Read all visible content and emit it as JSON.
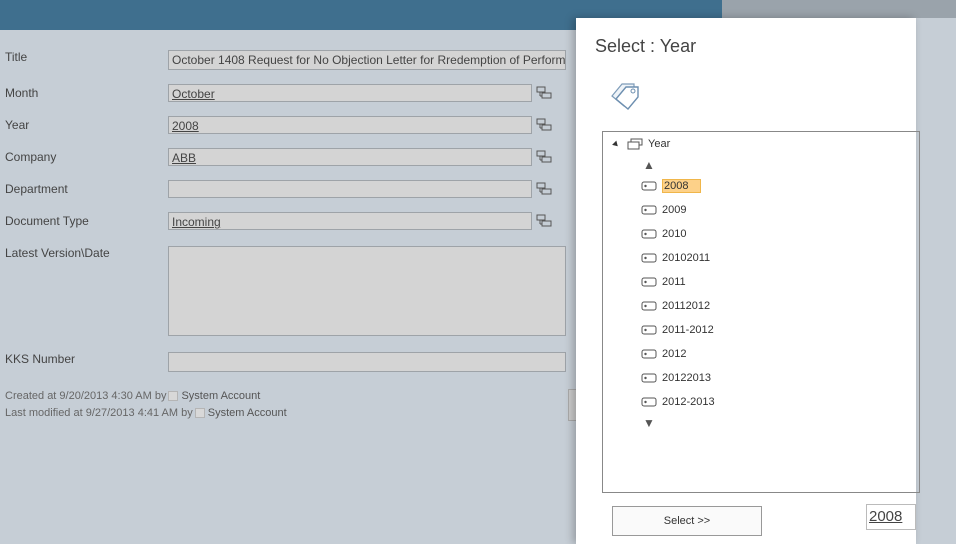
{
  "form": {
    "fields": [
      {
        "label": "Title",
        "value": "October 1408 Request for No Objection Letter for Rredemption of Perform"
      },
      {
        "label": "Month",
        "value": "October"
      },
      {
        "label": "Year",
        "value": "2008"
      },
      {
        "label": "Company",
        "value": "ABB"
      },
      {
        "label": "Department",
        "value": ""
      },
      {
        "label": "Document Type",
        "value": "Incoming"
      },
      {
        "label": "Latest Version\\Date",
        "value": ""
      },
      {
        "label": "KKS Number",
        "value": ""
      }
    ],
    "created_text": "Created at 9/20/2013 4:30 AM  by",
    "created_by": "System Account",
    "modified_text": "Last modified at 9/27/2013 4:41 AM  by",
    "modified_by": "System Account"
  },
  "dialog": {
    "title": "Select : Year",
    "tree_root": "Year",
    "terms": [
      "2008",
      "2009",
      "2010",
      "20102011",
      "2011",
      "20112012",
      "2011-2012",
      "2012",
      "20122013",
      "2012-2013"
    ],
    "select_button": "Select >>",
    "selected_value": "2008"
  },
  "colors": {
    "topbar": "#3f6f8e",
    "selection": "#fdd189"
  }
}
